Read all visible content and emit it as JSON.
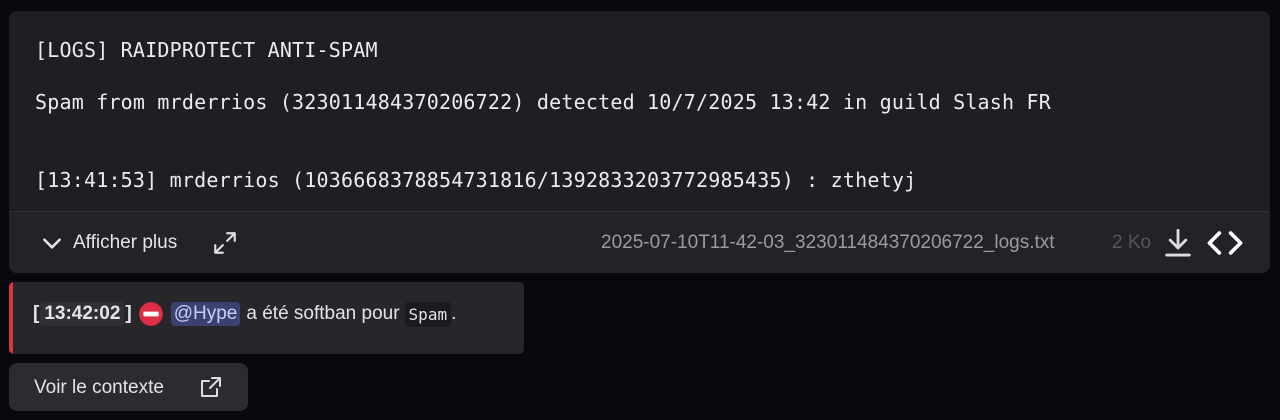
{
  "file_preview": {
    "lines": [
      "[LOGS] RAIDPROTECT ANTI-SPAM",
      "Spam from mrderrios (323011484370206722) detected 10/7/2025 13:42 in guild Slash FR",
      "",
      "[13:41:53] mrderrios (1036668378854731816/1392833203772985435) : zthetyj"
    ]
  },
  "file_footer": {
    "expand_label": "Afficher plus",
    "file_name": "2025-07-10T11-42-03_323011484370206722_logs.txt",
    "file_size": "2 Ko"
  },
  "embed": {
    "timestamp": "13:42:02",
    "mention": "@Hype",
    "text": "a été softban pour",
    "reason": "Spam",
    "suffix": ".",
    "accent_color": "#da373c"
  },
  "context_button": {
    "label": "Voir le contexte"
  }
}
